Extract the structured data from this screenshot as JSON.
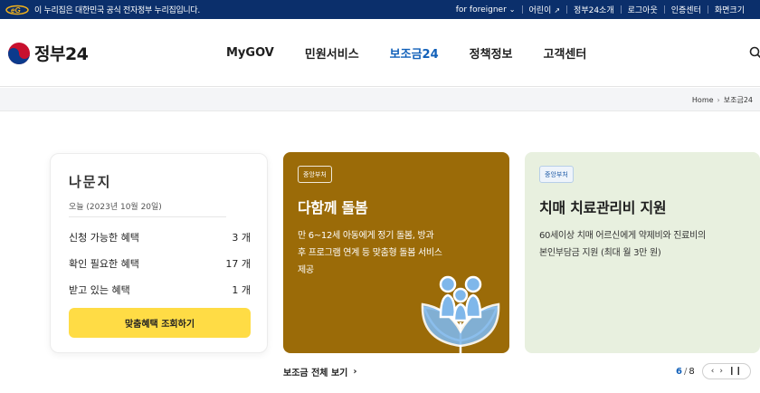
{
  "gov_banner": {
    "notice": "이 누리집은 대한민국 공식 전자정부 누리집입니다.",
    "links": [
      "for foreigner",
      "어린이",
      "정부24소개",
      "로그아웃",
      "인증센터",
      "화면크기"
    ]
  },
  "header": {
    "logo_text": "정부24",
    "nav": [
      "MyGOV",
      "민원서비스",
      "보조금24",
      "정책정보",
      "고객센터"
    ],
    "active_nav": "보조금24"
  },
  "breadcrumb": [
    "Home",
    "보조금24"
  ],
  "user_card": {
    "name": "나문지",
    "date": "오늘 (2023년 10월 20일)",
    "stats": [
      {
        "label": "신청 가능한 혜택",
        "count": "3",
        "unit": "개"
      },
      {
        "label": "확인 필요한 혜택",
        "count": "17",
        "unit": "개"
      },
      {
        "label": "받고 있는 혜택",
        "count": "1",
        "unit": "개"
      }
    ],
    "cta_label": "맞춤혜택 조회하기"
  },
  "cards": [
    {
      "badge": "중앙부처",
      "title": "다함께 돌봄",
      "desc": "만 6~12세 아동에게 정기 돌봄, 방과 후 프로그램 연계 등 맞춤형 돌봄 서비스 제공",
      "bg": "#9b6b08"
    },
    {
      "badge": "중앙부처",
      "title": "치매 치료관리비 지원",
      "desc": "60세이상 치매 어르신에게 약제비와 진료비의 본인부담금 지원 (최대 월 3만 원)",
      "bg": "#e8f0df"
    }
  ],
  "more_link": "보조금 전체 보기",
  "pager": {
    "current": "6",
    "total": "8"
  },
  "colors": {
    "banner": "#0b2f6b",
    "accent": "#1160b9",
    "cta": "#ffdc45"
  }
}
